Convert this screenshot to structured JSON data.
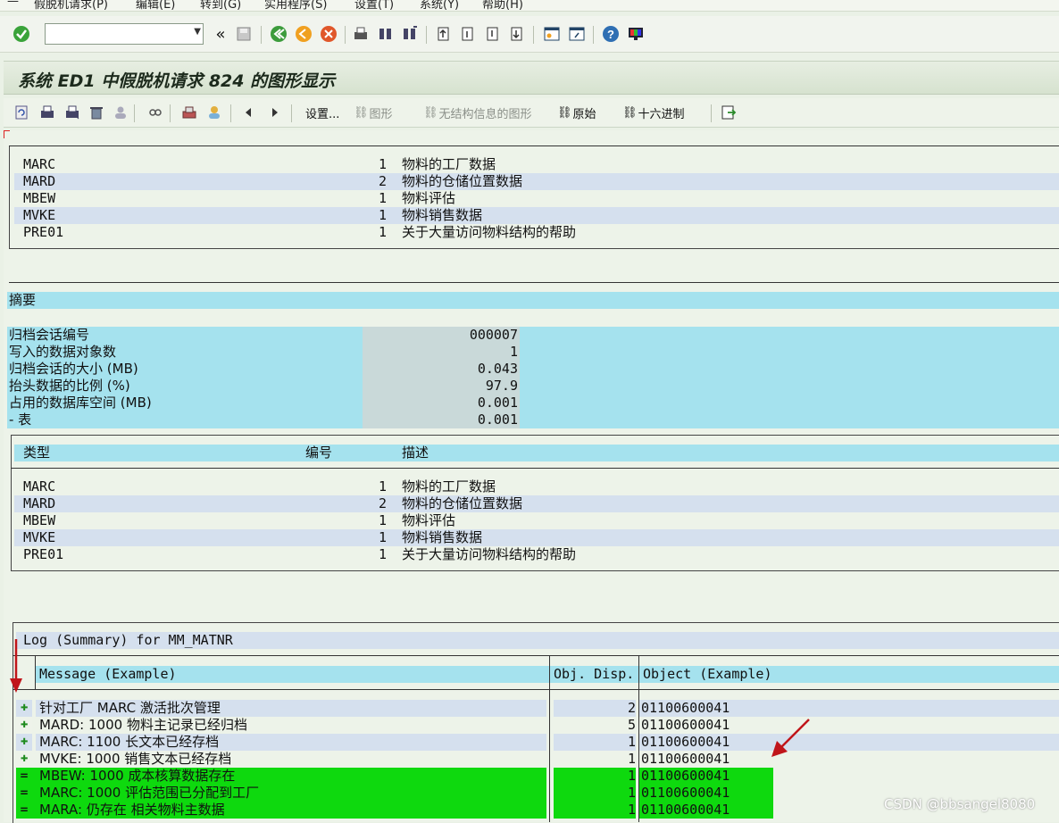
{
  "menu": [
    "假脱机请求(P)",
    "编辑(E)",
    "转到(G)",
    "实用程序(S)",
    "设置(T)",
    "系统(Y)",
    "帮助(H)"
  ],
  "toolbar": {
    "command_field_value": "",
    "back_glyph": "«"
  },
  "title": "系统 ED1 中假脱机请求 824 的图形显示",
  "app_toolbar": {
    "settings_label": "设置...",
    "graphic_label": "图形",
    "unstructured_graphic_label": "无结构信息的图形",
    "raw_label": "原始",
    "hex_label": "十六进制"
  },
  "top_list": [
    {
      "type": "MARC",
      "num": "1",
      "desc": "物料的工厂数据"
    },
    {
      "type": "MARD",
      "num": "2",
      "desc": "物料的仓储位置数据"
    },
    {
      "type": "MBEW",
      "num": "1",
      "desc": "物料评估"
    },
    {
      "type": "MVKE",
      "num": "1",
      "desc": "物料销售数据"
    },
    {
      "type": "PRE01",
      "num": "1",
      "desc": "关于大量访问物料结构的帮助"
    }
  ],
  "summary": {
    "heading": "摘要",
    "rows": [
      {
        "label": "归档会话编号",
        "value": "000007"
      },
      {
        "label": "写入的数据对象数",
        "value": "1"
      },
      {
        "label": "归档会话的大小 (MB)",
        "value": "0.043"
      },
      {
        "label": "抬头数据的比例 (%)",
        "value": "97.9"
      },
      {
        "label": "占用的数据库空间 (MB)",
        "value": "0.001"
      },
      {
        "label": "- 表",
        "value": "0.001"
      }
    ]
  },
  "type_table": {
    "headers": [
      "类型",
      "编号",
      "描述"
    ],
    "rows": [
      {
        "type": "MARC",
        "num": "1",
        "desc": "物料的工厂数据"
      },
      {
        "type": "MARD",
        "num": "2",
        "desc": "物料的仓储位置数据"
      },
      {
        "type": "MBEW",
        "num": "1",
        "desc": "物料评估"
      },
      {
        "type": "MVKE",
        "num": "1",
        "desc": "物料销售数据"
      },
      {
        "type": "PRE01",
        "num": "1",
        "desc": "关于大量访问物料结构的帮助"
      }
    ]
  },
  "log": {
    "title": "Log (Summary) for MM_MATNR",
    "headers": [
      "Message (Example)",
      "Obj. Disp.",
      "Object (Example)"
    ],
    "rows": [
      {
        "msg": "针对工厂 MARC 激活批次管理",
        "count": "2",
        "obj": "01100600041",
        "highlight": false
      },
      {
        "msg": "MARD: 1000 物料主记录已经归档",
        "count": "5",
        "obj": "01100600041",
        "highlight": false
      },
      {
        "msg": "MARC: 1100 长文本已经存档",
        "count": "1",
        "obj": "01100600041",
        "highlight": false
      },
      {
        "msg": "MVKE: 1000 销售文本已经存档",
        "count": "1",
        "obj": "01100600041",
        "highlight": false
      },
      {
        "msg": "MBEW: 1000 成本核算数据存在",
        "count": "1",
        "obj": "01100600041",
        "highlight": true
      },
      {
        "msg": "MARC: 1000 评估范围已分配到工厂",
        "count": "1",
        "obj": "01100600041",
        "highlight": true
      },
      {
        "msg": "MARA: 仍存在 相关物料主数据",
        "count": "1",
        "obj": "01100600041",
        "highlight": true
      }
    ]
  },
  "watermark": "CSDN @bbsangel8080",
  "colors": {
    "highlight_green": "#0ed90e",
    "row_blue": "#d5e0ee",
    "header_cyan": "#a5e2ee",
    "annotation_red": "#c0151a"
  }
}
